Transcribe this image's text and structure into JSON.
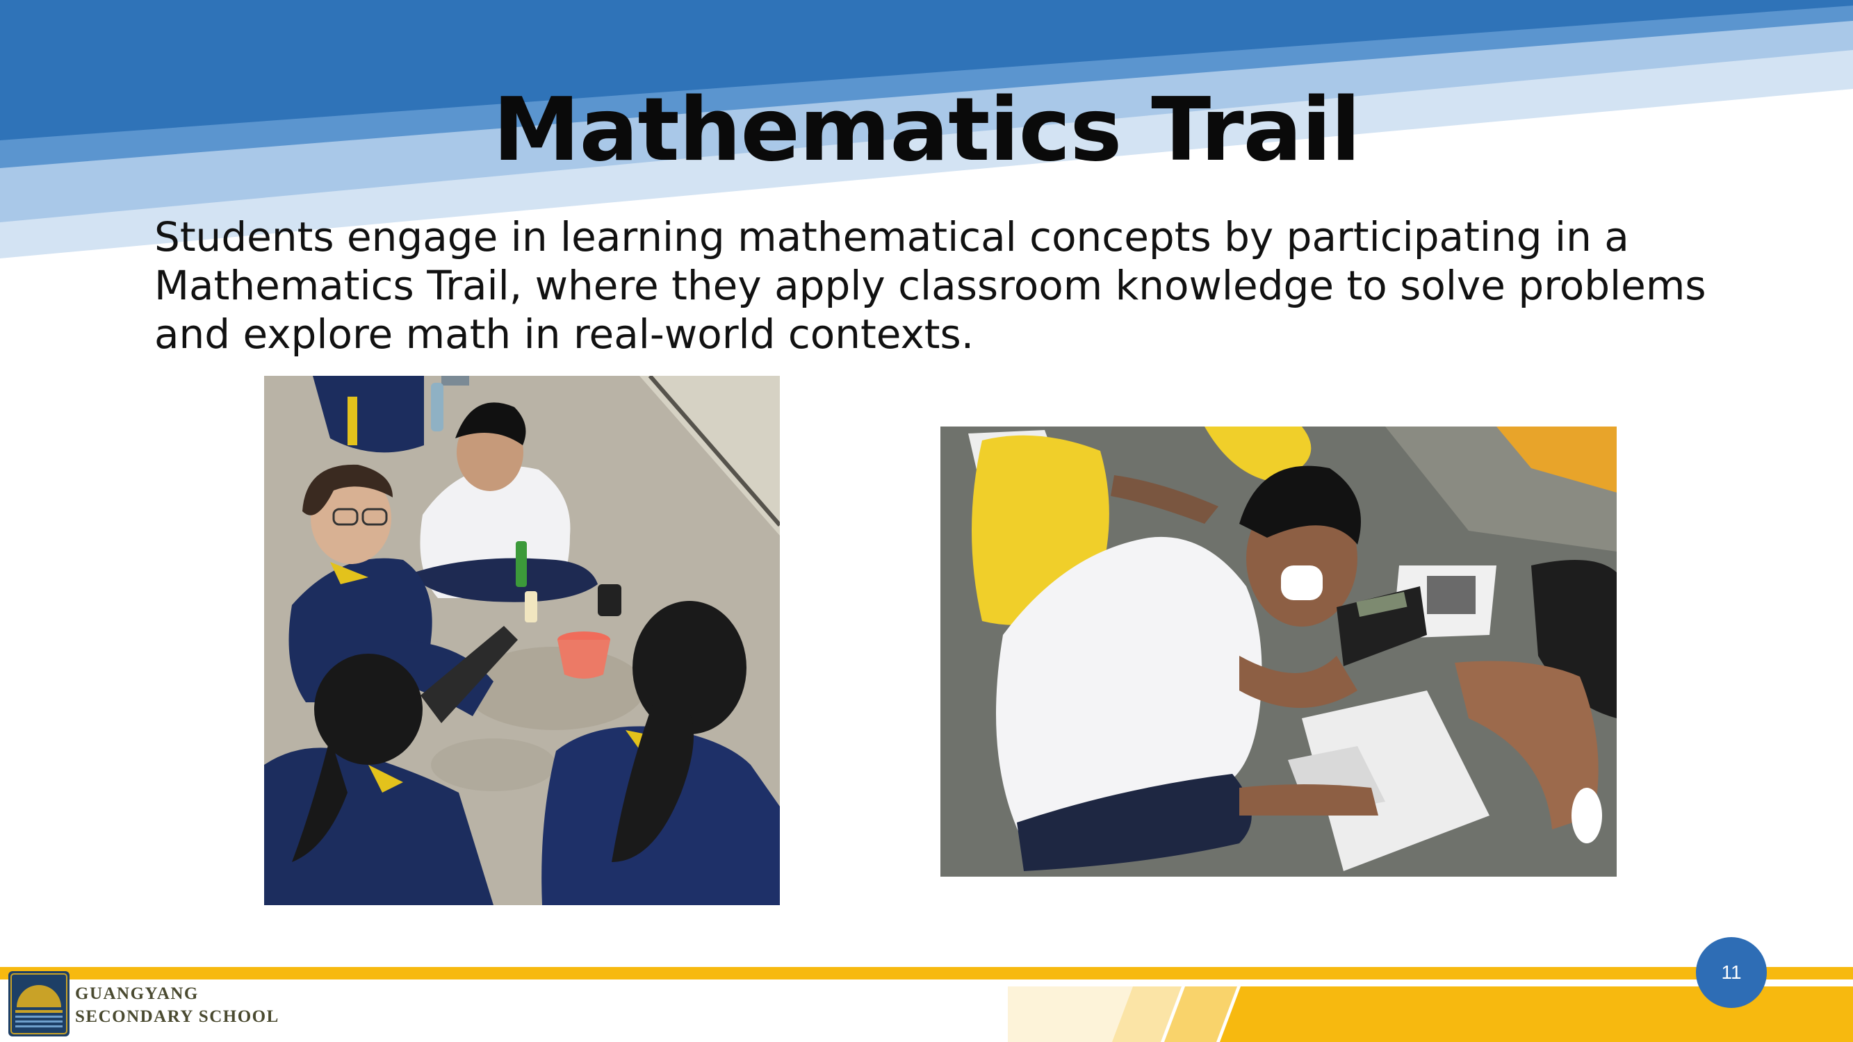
{
  "slide": {
    "title": "Mathematics Trail",
    "body_lines": [
      "Students engage in learning mathematical concepts by participating in a",
      "Mathematics Trail, where they apply classroom knowledge to solve problems",
      "and explore math in real-world contexts."
    ],
    "page_number": "11"
  },
  "footer": {
    "school_name_line1": "GUANGYANG",
    "school_name_line2": "SECONDARY SCHOOL"
  },
  "photos": [
    {
      "name": "students-sitting-on-floor-photo",
      "icon": "photo-icon"
    },
    {
      "name": "student-using-calculator-photo",
      "icon": "photo-icon"
    }
  ],
  "colors": {
    "banner_dark": "#2f73b8",
    "banner_mid": "#5b95cf",
    "banner_light": "#a9c8e8",
    "banner_pale": "#d3e3f3",
    "accent_yellow": "#f7b90f",
    "page_badge": "#2e6db5",
    "logo_navy": "#1d3f66",
    "logo_gold": "#c9a227"
  }
}
